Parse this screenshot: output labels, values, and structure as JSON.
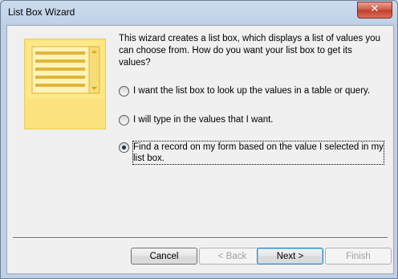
{
  "window": {
    "title": "List Box Wizard",
    "close_glyph": "✕"
  },
  "intro_text": "This wizard creates a list box, which displays a list of values you can choose from.  How do you want your list box to get its values?",
  "options": [
    {
      "label": "I want the list box to look up the values in a table or query.",
      "checked": false
    },
    {
      "label": "I will type in the values that I want.",
      "checked": false
    },
    {
      "label": "Find a record on my form based on the value I selected in my list box.",
      "checked": true
    }
  ],
  "buttons": {
    "cancel": "Cancel",
    "back": "< Back",
    "next": "Next >",
    "finish": "Finish"
  },
  "icons": {
    "illustration": "list-box-illustration-icon"
  },
  "colors": {
    "illustration_fill": "#fde98a",
    "illustration_border": "#e8b830"
  }
}
